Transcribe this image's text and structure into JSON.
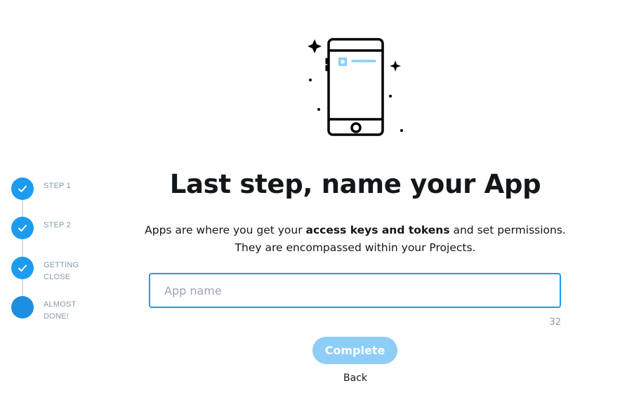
{
  "steps": [
    {
      "label": "STEP 1",
      "status": "complete",
      "icon": "check-icon"
    },
    {
      "label": "STEP 2",
      "status": "complete",
      "icon": "check-icon"
    },
    {
      "label": "GETTING CLOSE",
      "status": "complete",
      "icon": "check-icon"
    },
    {
      "label": "ALMOST DONE!",
      "status": "current",
      "icon": ""
    }
  ],
  "illustration": {
    "icon": "smartphone-sparkle-icon"
  },
  "main": {
    "title": "Last step, name your App",
    "desc_part1": "Apps are where you get your ",
    "desc_bold": "access keys and tokens",
    "desc_part2": " and set permissions.",
    "desc_line2": "They are encompassed within your Projects."
  },
  "app_name": {
    "value": "",
    "placeholder": "App name",
    "counter": "32"
  },
  "actions": {
    "complete_label": "Complete",
    "back_label": "Back"
  },
  "colors": {
    "accent": "#1d9bf0",
    "button_disabled": "#8ecdf7",
    "muted_text": "#8899a6"
  }
}
